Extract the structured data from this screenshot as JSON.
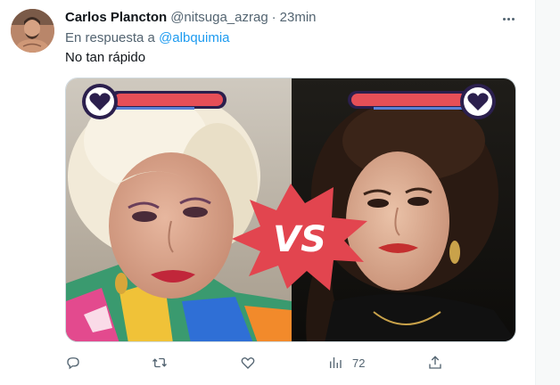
{
  "tweet": {
    "display_name": "Carlos Plancton",
    "handle": "@nitsuga_azrag",
    "separator": "·",
    "time": "23min",
    "reply_prefix": "En respuesta a ",
    "reply_to": "@albquimia",
    "text": "No tan rápido"
  },
  "media": {
    "vs_label": "VS",
    "heart_icon": "heart-icon",
    "colors": {
      "burst": "#e2454f",
      "health_bar": "#e64f57",
      "heart": "#2b1f4d"
    }
  },
  "actions": {
    "reply_icon": "reply-icon",
    "retweet_icon": "retweet-icon",
    "like_icon": "like-icon",
    "views_icon": "views-icon",
    "views_count": "72",
    "share_icon": "share-icon"
  },
  "colors": {
    "accent": "#1d9bf0",
    "muted_text": "#536471"
  }
}
